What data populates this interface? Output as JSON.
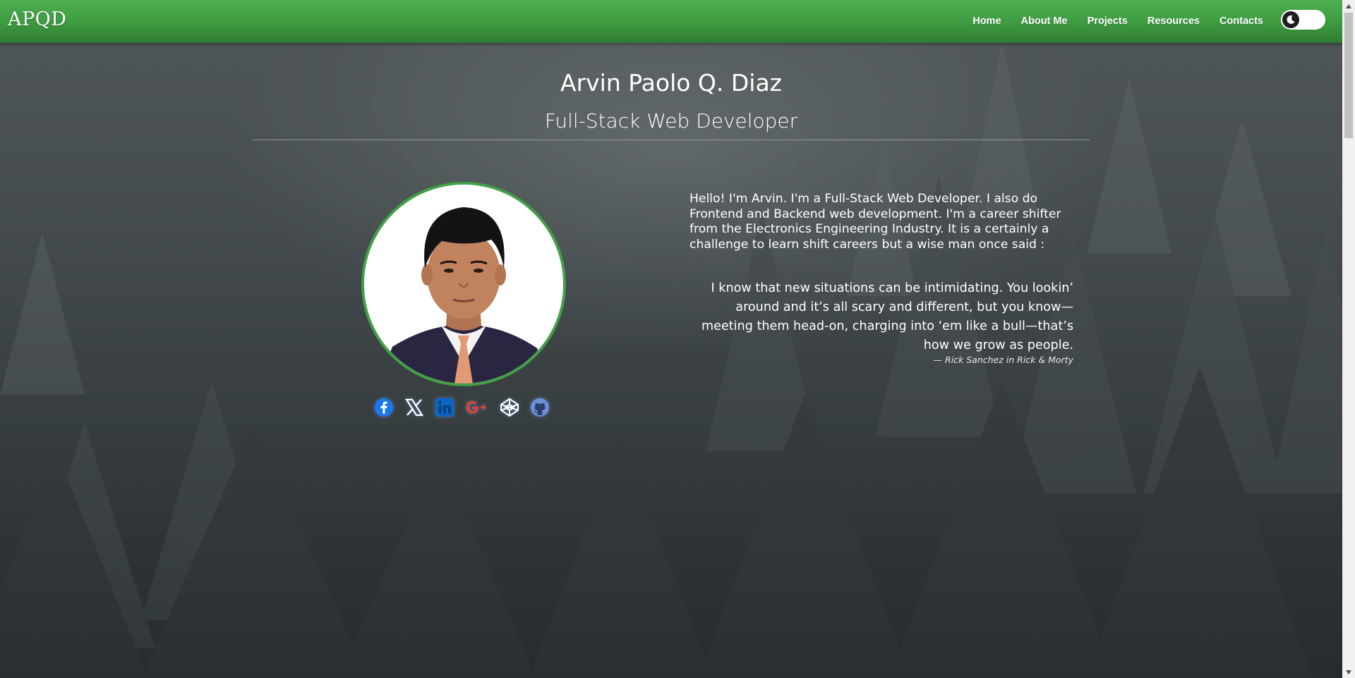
{
  "brand": "APQD",
  "nav": {
    "links": [
      "Home",
      "About Me",
      "Projects",
      "Resources",
      "Contacts"
    ]
  },
  "theme_toggle": {
    "icon": "moon-icon",
    "state": "dark"
  },
  "hero": {
    "name": "Arvin Paolo Q. Diaz",
    "title": "Full-Stack Web Developer"
  },
  "about": {
    "intro": "Hello! I'm Arvin. I'm a Full-Stack Web Developer. I also do Frontend and Backend web development. I'm a career shifter from the Electronics Engineering Industry. It is a certainly a challenge to learn shift careers but a wise man once said :",
    "quote": "I know that new situations can be intimidating. You lookin’ around and it’s all scary and different, but you know—meeting them head-on, charging into ‘em like a bull—that’s how we grow as people.",
    "cite": "— Rick Sanchez in Rick & Morty"
  },
  "social": [
    {
      "icon": "facebook-icon",
      "color": "#1877f2"
    },
    {
      "icon": "x-icon",
      "color": "#ffffff"
    },
    {
      "icon": "linkedin-icon",
      "color": "#0a66c2"
    },
    {
      "icon": "google-plus-icon",
      "color": "#db4437"
    },
    {
      "icon": "codepen-icon",
      "color": "#ffffff"
    },
    {
      "icon": "github-icon",
      "color": "#6e8fd6"
    }
  ],
  "colors": {
    "navbar": "#4caf50",
    "avatar_border": "#43a047",
    "text": "#ffffff"
  }
}
